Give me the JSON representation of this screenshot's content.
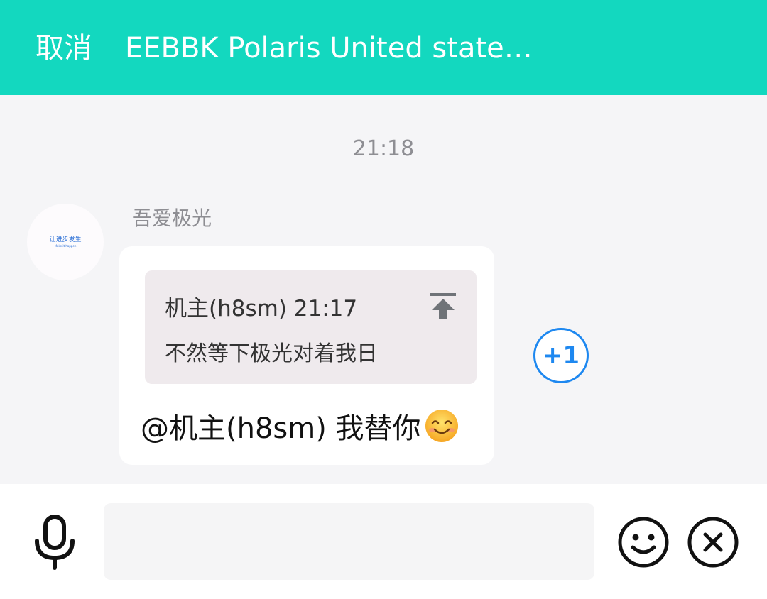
{
  "header": {
    "cancel_label": "取消",
    "title": "EEBBK Polaris United states…"
  },
  "chat": {
    "timestamp": "21:18",
    "message": {
      "sender": "吾爱极光",
      "avatar_text": "让进步发生",
      "avatar_subtext": "Make it happen",
      "quote": {
        "header": "机主(h8sm) 21:17",
        "text": "不然等下极光对着我日"
      },
      "text": "@机主(h8sm) 我替你",
      "emoji": "smiling-face-emoji"
    },
    "plus_one_label": "+1"
  },
  "composer": {
    "input_value": "",
    "input_placeholder": "",
    "mic_icon": "mic-icon",
    "emoji_icon": "smile-icon",
    "close_icon": "close-icon"
  },
  "colors": {
    "accent": "#13d8bf",
    "plus_one": "#1e88f0"
  }
}
